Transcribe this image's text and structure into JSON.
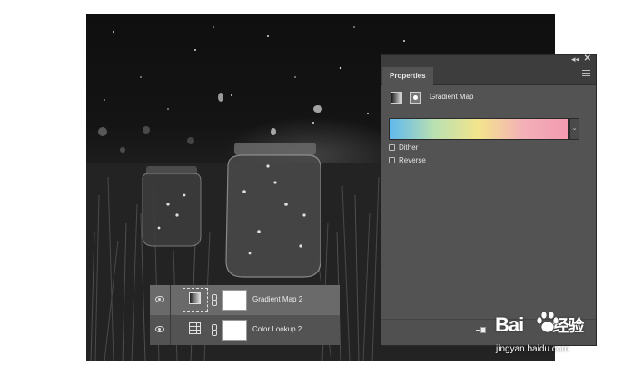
{
  "properties_panel": {
    "tab_label": "Properties",
    "adjustment_title": "Gradient Map",
    "gradient_colors": [
      "#60b8ee",
      "#b9e0b2",
      "#f3e58c",
      "#f3b0b8",
      "#f39ab0"
    ],
    "options": [
      {
        "label": "Dither",
        "checked": false
      },
      {
        "label": "Reverse",
        "checked": false
      }
    ],
    "collapse_glyph": "◂◂",
    "close_glyph": "✕",
    "dropdown_glyph": "⌄"
  },
  "layers_panel": {
    "layers": [
      {
        "name": "Gradient Map 2",
        "selected": true,
        "icon": "gradient-map-icon"
      },
      {
        "name": "Color Lookup 2",
        "selected": false,
        "icon": "color-lookup-icon"
      }
    ]
  },
  "watermark": {
    "logo_text": "Bai",
    "logo_suffix": "经验",
    "url": "jingyan.baidu.com"
  }
}
